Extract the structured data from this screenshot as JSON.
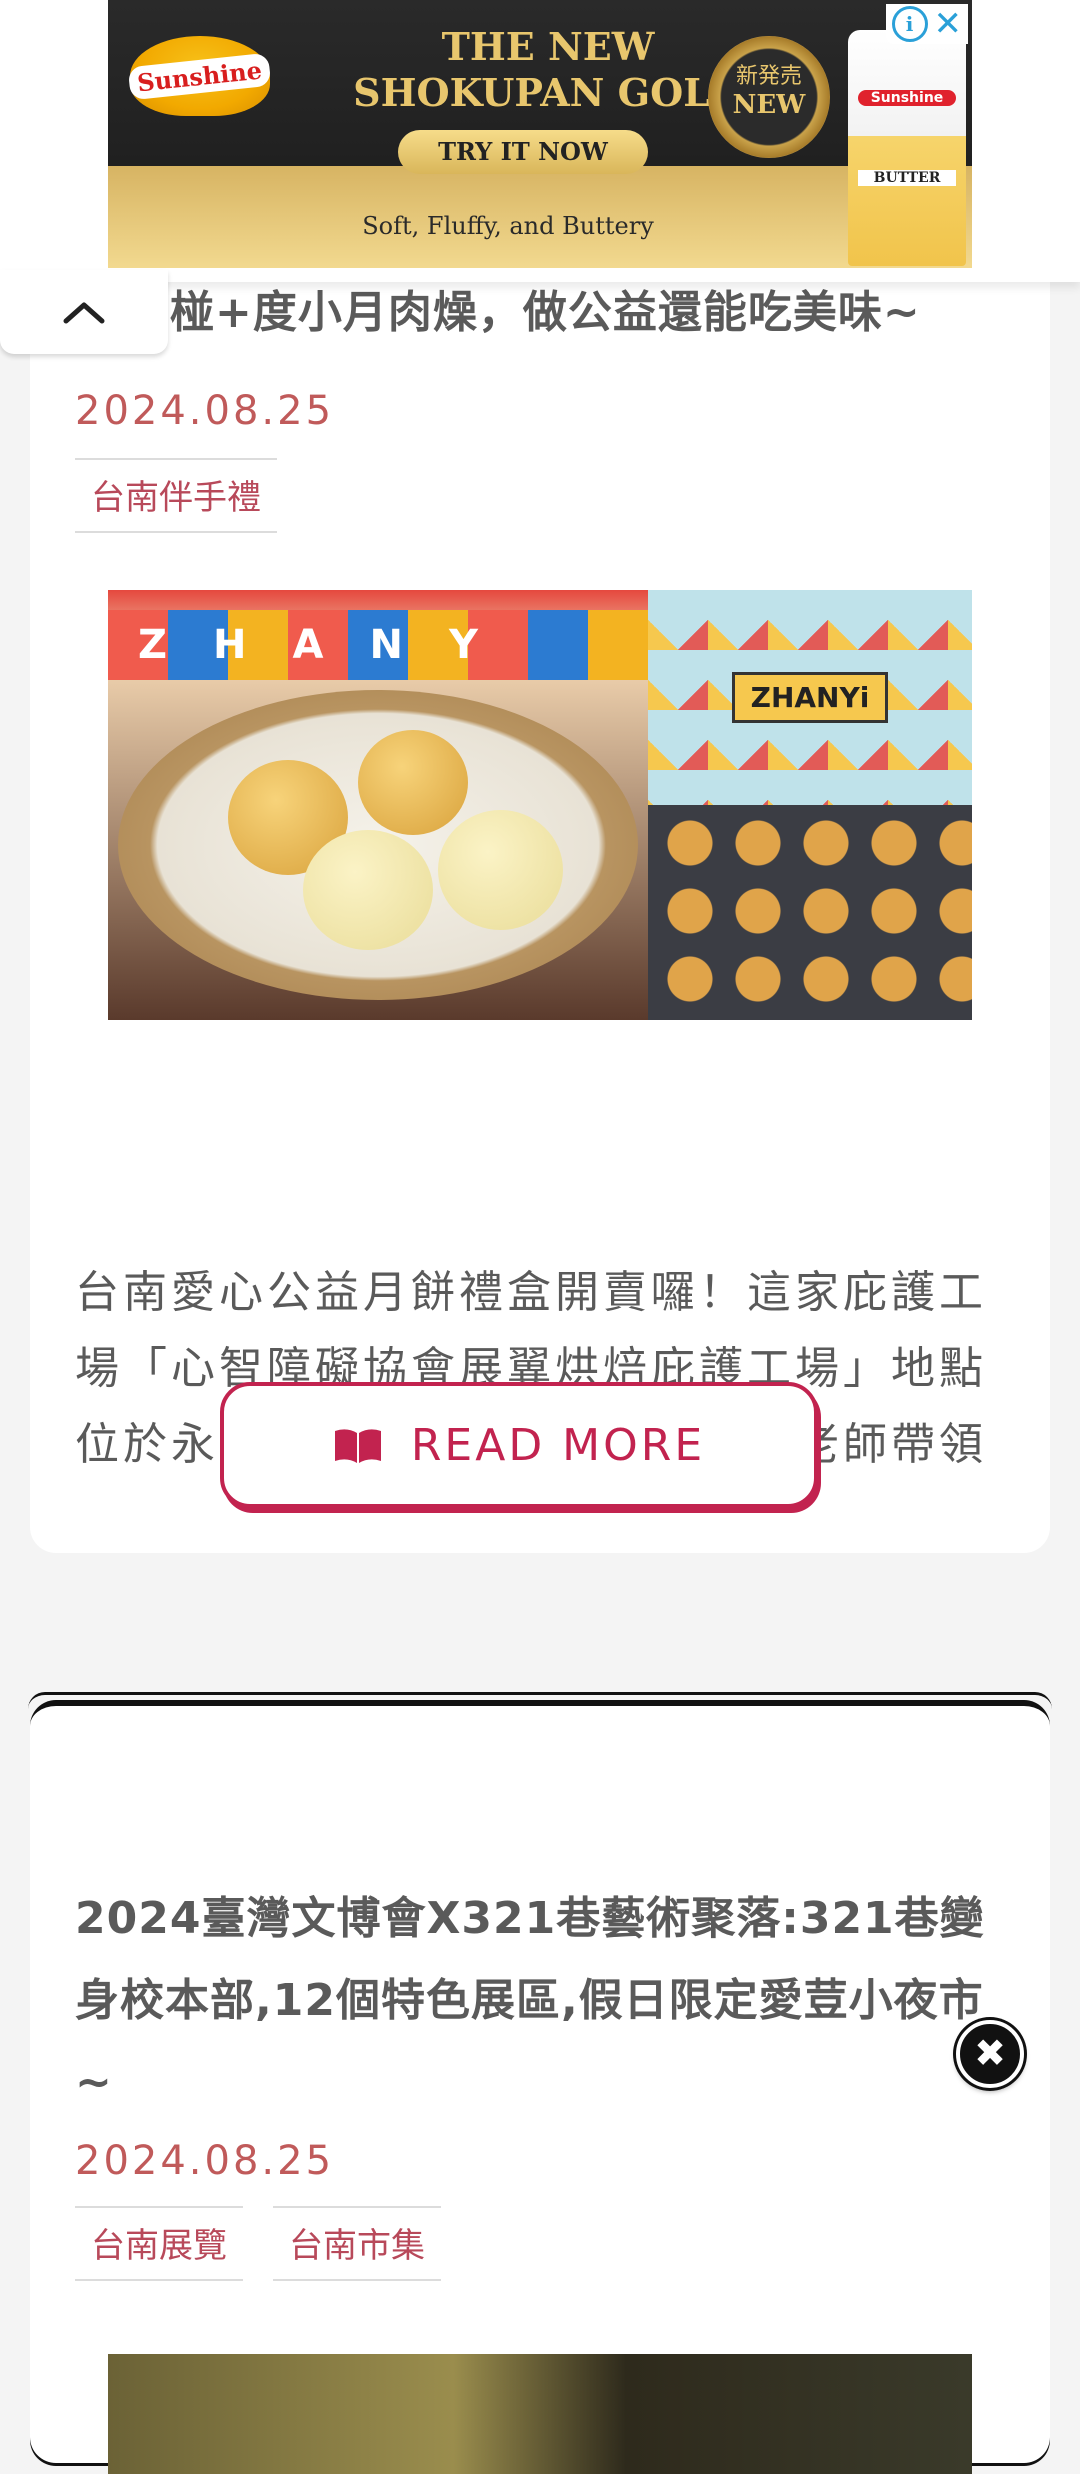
{
  "ad": {
    "brand": "Sunshine",
    "headline_line1": "THE NEW",
    "headline_line2": "SHOKUPAN GOLD",
    "cta": "TRY IT NOW",
    "seal_top": "新発売",
    "seal_bottom": "NEW",
    "product_brand": "Sunshine",
    "product_label": "BUTTER",
    "tagline": "Soft, Fluffy, and Buttery",
    "info_icon": "info-icon",
    "close_icon": "close-icon",
    "accent": "#2aa0d8"
  },
  "collapse_tab": {
    "icon": "chevron-up-icon"
  },
  "posts": [
    {
      "title_visible": "椪+度小月肉燥，做公益還能吃美味~",
      "date": "2024.08.25",
      "tags": [
        "台南伴手禮"
      ],
      "image_text_banner": [
        "Z",
        "H",
        "A",
        "N",
        "Y"
      ],
      "image_box_text": "ZHANYi",
      "excerpt": "台南愛心公益月餅禮盒開賣囉！這家庇護工場「心智障礙協會展翼烘焙庇護工場」地點位於永康富強路上，是由專業指導老師帶領",
      "read_more": "READ MORE",
      "read_more_icon": "book-icon"
    },
    {
      "title": "2024臺灣文博會X321巷藝術聚落:321巷變身校本部,12個特色展區,假日限定愛荳小夜市~",
      "date": "2024.08.25",
      "tags": [
        "台南展覽",
        "台南市集"
      ]
    }
  ],
  "floating_close": {
    "icon": "close-circle-icon",
    "glyph": "✖"
  },
  "colors": {
    "date": "#c05a5a",
    "tag": "#b8495a",
    "button": "#c2234f",
    "text": "#5a5a5a"
  }
}
